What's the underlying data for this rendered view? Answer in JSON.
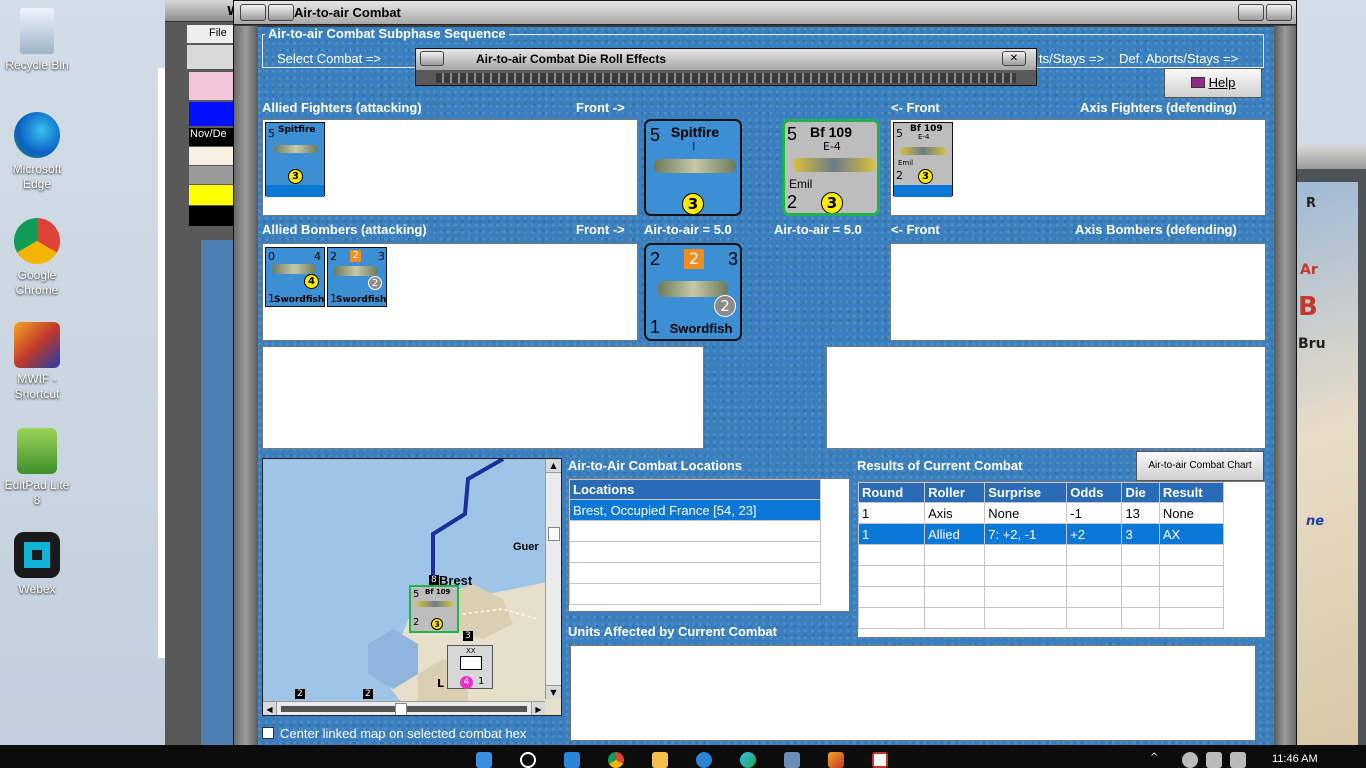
{
  "desktop": {
    "icons": [
      {
        "label": "Recycle Bin"
      },
      {
        "label": "Microsoft Edge"
      },
      {
        "label": "Google Chrome"
      },
      {
        "label": "MWIF - Shortcut"
      },
      {
        "label": "EditPad Lite 8"
      },
      {
        "label": "Webex"
      }
    ]
  },
  "bg_window": {
    "title_fragment": "W",
    "menu_file": "File",
    "date_text": "Nov/De"
  },
  "right_window": {
    "letters": [
      "R",
      "Ar",
      "B",
      "Bru",
      "ne"
    ]
  },
  "window": {
    "title": "Air-to-air Combat"
  },
  "subphase": {
    "caption": "Air-to-air Combat Subphase Sequence",
    "step_select": "Select Combat =>",
    "step_att_aborts": "ts/Stays =>",
    "step_def_aborts": "Def. Aborts/Stays =>"
  },
  "die_dialog": {
    "title": "Air-to-air Combat Die Roll Effects"
  },
  "help_label": "Help",
  "sections": {
    "allied_fighters": "Allied Fighters (attacking)",
    "front_right": "Front ->",
    "front_left": "<- Front",
    "axis_fighters": "Axis Fighters (defending)",
    "allied_bombers": "Allied Bombers (attacking)",
    "front_right_2": "Front ->",
    "air_to_air_allied": "Air-to-air = 5.0",
    "air_to_air_axis": "Air-to-air = 5.0",
    "front_left_2": "<- Front",
    "axis_bombers": "Axis Bombers (defending)"
  },
  "units": {
    "spitfire": {
      "name": "Spitfire",
      "model": "I",
      "attack": "5",
      "move": "3"
    },
    "bf109": {
      "name": "Bf 109",
      "model": "E-4",
      "nickname": "Emil",
      "attack": "5",
      "defense": "2",
      "move": "3"
    },
    "swordfish": {
      "name": "Swordfish",
      "top_left": "2",
      "top_center": "2",
      "top_right": "3",
      "defense": "1",
      "badge": "2"
    },
    "swordfish_mini1": {
      "name": "Swordfish",
      "left": "0",
      "right": "4",
      "def": "1",
      "badge": "4"
    },
    "swordfish_mini2": {
      "name": "Swordfish",
      "left": "2",
      "center": "2",
      "right": "3",
      "def": "1",
      "badge": "2"
    }
  },
  "locations": {
    "heading": "Air-to-Air Combat Locations",
    "column": "Locations",
    "rows": [
      "Brest, Occupied France [54, 23]"
    ]
  },
  "results": {
    "heading": "Results of Current Combat",
    "chart_button": "Air-to-air Combat Chart",
    "columns": [
      "Round",
      "Roller",
      "Surprise",
      "Odds",
      "Die",
      "Result"
    ],
    "rows": [
      [
        "1",
        "Axis",
        "None",
        "-1",
        "13",
        "None"
      ],
      [
        "1",
        "Allied",
        "7: +2, -1",
        "+2",
        "3",
        "AX"
      ]
    ]
  },
  "affected_heading": "Units Affected by Current Combat",
  "map": {
    "city": "Brest",
    "city_partial": "Guer",
    "hex_counts": [
      "8",
      "3",
      "2",
      "2"
    ],
    "division_strength": "4",
    "division_move": "1",
    "division_size": "XX",
    "division_letter": "L"
  },
  "center_checkbox": {
    "label": "Center linked map on selected combat hex",
    "checked": false
  },
  "taskbar": {
    "time": "11:46 AM"
  }
}
